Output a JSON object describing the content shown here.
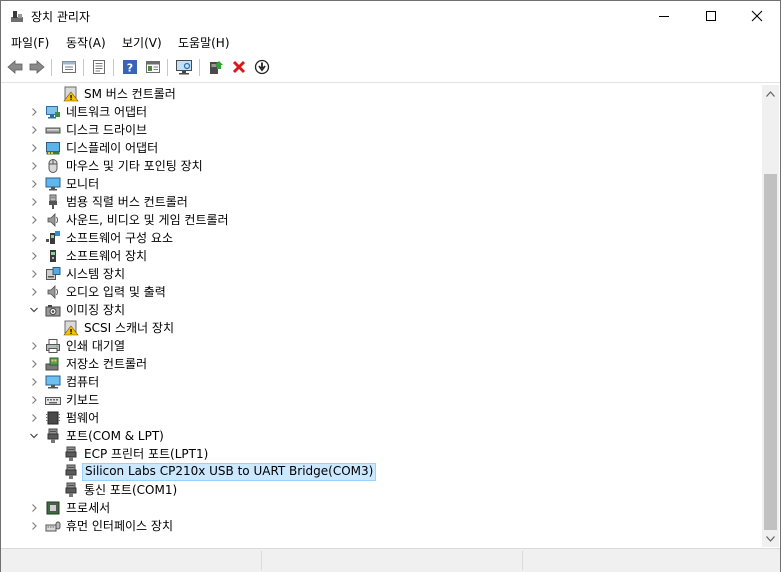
{
  "window": {
    "title": "장치 관리자"
  },
  "menu": {
    "file": "파일(F)",
    "action": "동작(A)",
    "view": "보기(V)",
    "help": "도움말(H)"
  },
  "toolbar": {
    "back": "back-arrow-icon",
    "forward": "forward-arrow-icon",
    "properties": "properties-icon",
    "view_details": "details-icon",
    "help": "help-icon",
    "view": "view-icon",
    "scan": "monitor-scan-icon",
    "update_driver": "update-driver-icon",
    "uninstall": "uninstall-x-icon",
    "disable": "disable-down-icon"
  },
  "colors": {
    "selection_bg": "#cce8ff",
    "selection_border": "#99d1ff",
    "uninstall_red": "#d7191c"
  },
  "tree": [
    {
      "label": "SM 버스 컨트롤러",
      "level": 1,
      "expander": "",
      "icon": "warning-device-icon"
    },
    {
      "label": "네트워크 어댑터",
      "level": 0,
      "expander": "collapsed",
      "icon": "network-adapter-icon"
    },
    {
      "label": "디스크 드라이브",
      "level": 0,
      "expander": "collapsed",
      "icon": "disk-drive-icon"
    },
    {
      "label": "디스플레이 어댑터",
      "level": 0,
      "expander": "collapsed",
      "icon": "display-adapter-icon"
    },
    {
      "label": "마우스 및 기타 포인팅 장치",
      "level": 0,
      "expander": "collapsed",
      "icon": "mouse-icon"
    },
    {
      "label": "모니터",
      "level": 0,
      "expander": "collapsed",
      "icon": "monitor-icon"
    },
    {
      "label": "범용 직렬 버스 컨트롤러",
      "level": 0,
      "expander": "collapsed",
      "icon": "usb-icon"
    },
    {
      "label": "사운드, 비디오 및 게임 컨트롤러",
      "level": 0,
      "expander": "collapsed",
      "icon": "speaker-icon"
    },
    {
      "label": "소프트웨어 구성 요소",
      "level": 0,
      "expander": "collapsed",
      "icon": "software-component-icon"
    },
    {
      "label": "소프트웨어 장치",
      "level": 0,
      "expander": "collapsed",
      "icon": "software-device-icon"
    },
    {
      "label": "시스템 장치",
      "level": 0,
      "expander": "collapsed",
      "icon": "system-device-icon"
    },
    {
      "label": "오디오 입력 및 출력",
      "level": 0,
      "expander": "collapsed",
      "icon": "speaker-icon"
    },
    {
      "label": "이미징 장치",
      "level": 0,
      "expander": "expanded",
      "icon": "camera-icon"
    },
    {
      "label": "SCSI 스캐너 장치",
      "level": 1,
      "expander": "",
      "icon": "warning-device-icon"
    },
    {
      "label": "인쇄 대기열",
      "level": 0,
      "expander": "collapsed",
      "icon": "printer-icon"
    },
    {
      "label": "저장소 컨트롤러",
      "level": 0,
      "expander": "collapsed",
      "icon": "storage-controller-icon"
    },
    {
      "label": "컴퓨터",
      "level": 0,
      "expander": "collapsed",
      "icon": "computer-icon"
    },
    {
      "label": "키보드",
      "level": 0,
      "expander": "collapsed",
      "icon": "keyboard-icon"
    },
    {
      "label": "펌웨어",
      "level": 0,
      "expander": "collapsed",
      "icon": "firmware-icon"
    },
    {
      "label": "포트(COM & LPT)",
      "level": 0,
      "expander": "expanded",
      "icon": "port-icon"
    },
    {
      "label": "ECP 프린터 포트(LPT1)",
      "level": 1,
      "expander": "",
      "icon": "port-icon"
    },
    {
      "label": "Silicon Labs CP210x USB to UART Bridge(COM3)",
      "level": 1,
      "expander": "",
      "icon": "port-icon",
      "selected": true
    },
    {
      "label": "통신 포트(COM1)",
      "level": 1,
      "expander": "",
      "icon": "port-icon"
    },
    {
      "label": "프로세서",
      "level": 0,
      "expander": "collapsed",
      "icon": "processor-icon"
    },
    {
      "label": "휴먼 인터페이스 장치",
      "level": 0,
      "expander": "collapsed",
      "icon": "hid-icon"
    }
  ]
}
